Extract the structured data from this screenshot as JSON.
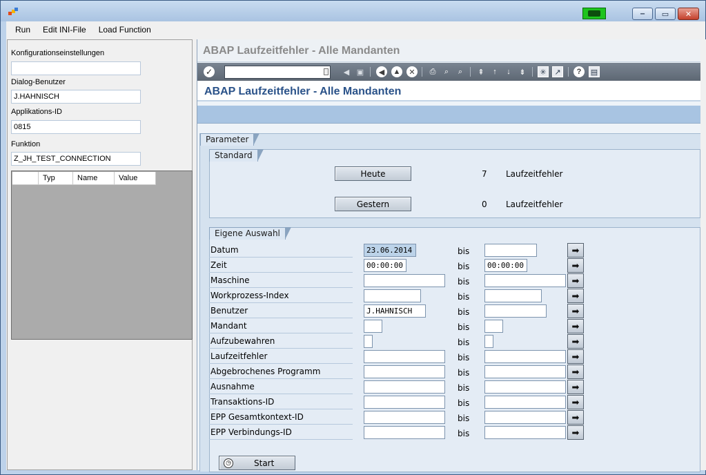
{
  "menu": {
    "run": "Run",
    "edit_ini": "Edit INI-File",
    "load_function": "Load Function"
  },
  "left": {
    "konfig_label": "Konfigurationseinstellungen",
    "konfig_value": "",
    "dialog_label": "Dialog-Benutzer",
    "dialog_value": "J.HAHNISCH",
    "appid_label": "Applikations-ID",
    "appid_value": "0815",
    "funktion_label": "Funktion",
    "funktion_value": "Z_JH_TEST_CONNECTION",
    "grid_columns": [
      "Typ",
      "Name",
      "Value"
    ]
  },
  "sap": {
    "screen_title": "ABAP Laufzeitfehler - Alle Mandanten",
    "command_value": "",
    "page_title": "ABAP Laufzeitfehler - Alle Mandanten",
    "parameter_tab": "Parameter",
    "standard_tab": "Standard",
    "heute_button": "Heute",
    "heute_count": "7",
    "heute_unit": "Laufzeitfehler",
    "gestern_button": "Gestern",
    "gestern_count": "0",
    "gestern_unit": "Laufzeitfehler",
    "eigene_tab": "Eigene Auswahl",
    "bis_label": "bis",
    "start_button": "Start",
    "rows": [
      {
        "label": "Datum",
        "from": "23.06.2014",
        "to": ""
      },
      {
        "label": "Zeit",
        "from": "00:00:00",
        "to": "00:00:00"
      },
      {
        "label": "Maschine",
        "from": "",
        "to": ""
      },
      {
        "label": "Workprozess-Index",
        "from": "",
        "to": ""
      },
      {
        "label": "Benutzer",
        "from": "J.HAHNISCH",
        "to": ""
      },
      {
        "label": "Mandant",
        "from": "",
        "to": ""
      },
      {
        "label": "Aufzubewahren",
        "from": "",
        "to": ""
      },
      {
        "label": "Laufzeitfehler",
        "from": "",
        "to": ""
      },
      {
        "label": "Abgebrochenes Programm",
        "from": "",
        "to": ""
      },
      {
        "label": "Ausnahme",
        "from": "",
        "to": ""
      },
      {
        "label": "Transaktions-ID",
        "from": "",
        "to": ""
      },
      {
        "label": "EPP Gesamtkontext-ID",
        "from": "",
        "to": ""
      },
      {
        "label": "EPP Verbindungs-ID",
        "from": "",
        "to": ""
      }
    ]
  },
  "icons": {
    "app": "app-logo-icon",
    "tray": "sap-connection-icon",
    "enter": "checkmark-icon",
    "arrow": "multiple-selection-arrow-icon"
  },
  "colors": {
    "title_blue": "#2a5289",
    "appbar": "#a8c4e2",
    "tray_green": "#1ec41e"
  }
}
